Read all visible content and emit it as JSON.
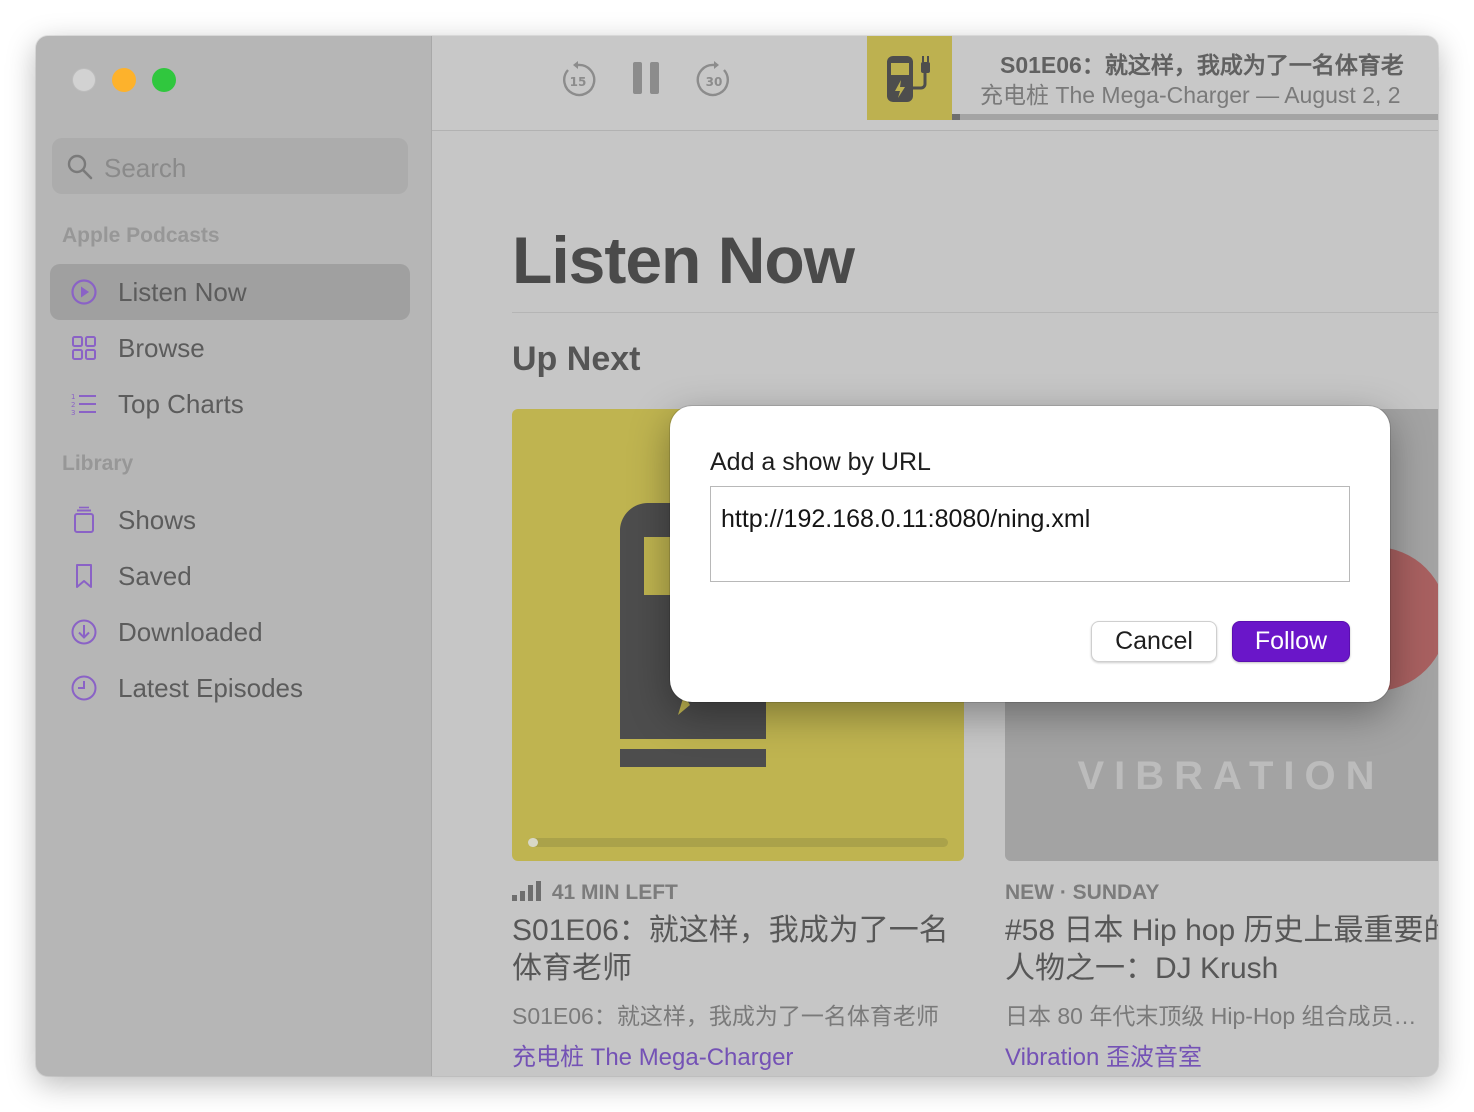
{
  "sidebar": {
    "search_placeholder": "Search",
    "sections": [
      {
        "heading": "Apple Podcasts",
        "items": [
          {
            "label": "Listen Now",
            "icon": "play-circle-icon",
            "selected": true
          },
          {
            "label": "Browse",
            "icon": "grid-icon"
          },
          {
            "label": "Top Charts",
            "icon": "list-icon"
          }
        ]
      },
      {
        "heading": "Library",
        "items": [
          {
            "label": "Shows",
            "icon": "stack-icon"
          },
          {
            "label": "Saved",
            "icon": "bookmark-icon"
          },
          {
            "label": "Downloaded",
            "icon": "download-icon"
          },
          {
            "label": "Latest Episodes",
            "icon": "clock-icon"
          }
        ]
      }
    ]
  },
  "toolbar": {
    "skip_back_seconds": "15",
    "skip_forward_seconds": "30",
    "now_playing": {
      "title": "S01E06：就这样，我成为了一名体育老",
      "subtitle": "充电桩 The Mega-Charger — August 2, 2"
    }
  },
  "main": {
    "page_title": "Listen Now",
    "section_title": "Up Next",
    "cards": [
      {
        "meta": "41 MIN LEFT",
        "title": "S01E06：就这样，我成为了一名体育老师",
        "description": "S01E06：就这样，我成为了一名体育老师",
        "show": "充电桩 The Mega-Charger",
        "art_color": "#bfb450"
      },
      {
        "meta": "NEW · SUNDAY",
        "title": "#58 日本 Hip hop 历史上最重要的人物之一：DJ Krush",
        "description": "日本 80 年代末顶级 Hip-Hop 组合成员…",
        "show": "Vibration 歪波音室",
        "art_text": "VIBRATION"
      }
    ]
  },
  "dialog": {
    "label": "Add a show by URL",
    "url_value": "http://192.168.0.11:8080/ning.xml",
    "cancel_label": "Cancel",
    "follow_label": "Follow",
    "accent_color": "#6a16c9"
  }
}
